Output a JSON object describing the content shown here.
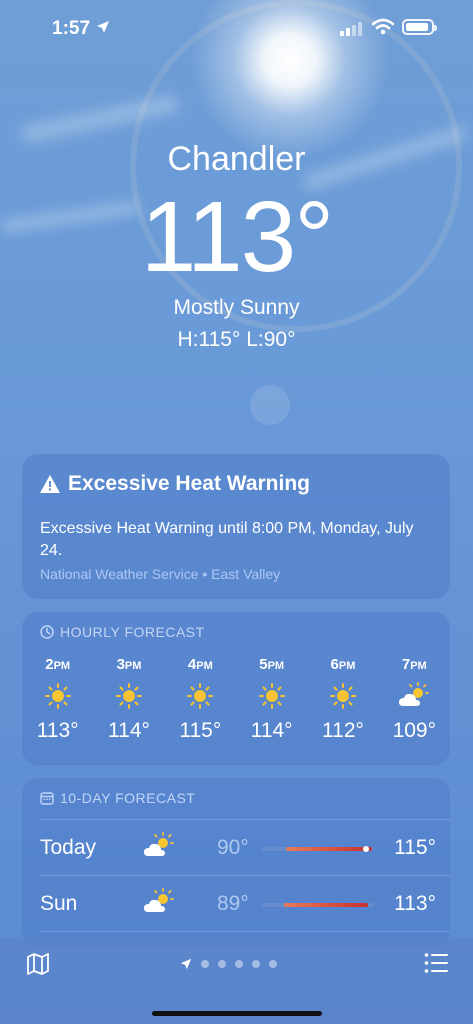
{
  "status": {
    "time": "1:57"
  },
  "location": {
    "city": "Chandler",
    "temperature": "113°",
    "condition": "Mostly Sunny",
    "hilo": "H:115°  L:90°"
  },
  "alert": {
    "title": "Excessive Heat Warning",
    "body": "Excessive Heat Warning until 8:00 PM, Monday, July 24.",
    "source": "National Weather Service • East Valley"
  },
  "hourly": {
    "title": "HOURLY FORECAST",
    "items": [
      {
        "hour": "2",
        "ampm": "PM",
        "icon": "sun-icon",
        "temp": "113°"
      },
      {
        "hour": "3",
        "ampm": "PM",
        "icon": "sun-icon",
        "temp": "114°"
      },
      {
        "hour": "4",
        "ampm": "PM",
        "icon": "sun-icon",
        "temp": "115°"
      },
      {
        "hour": "5",
        "ampm": "PM",
        "icon": "sun-icon",
        "temp": "114°"
      },
      {
        "hour": "6",
        "ampm": "PM",
        "icon": "sun-icon",
        "temp": "112°"
      },
      {
        "hour": "7",
        "ampm": "PM",
        "icon": "partly-cloudy-icon",
        "temp": "109°"
      }
    ]
  },
  "daily": {
    "title": "10-DAY FORECAST",
    "days": [
      {
        "name": "Today",
        "icon": "partly-cloudy-icon",
        "low": "90°",
        "high": "115°"
      },
      {
        "name": "Sun",
        "icon": "partly-cloudy-icon",
        "low": "89°",
        "high": "113°"
      }
    ]
  },
  "colors": {
    "accent_sun": "#f7c531",
    "temp_bar": "#c83030"
  }
}
